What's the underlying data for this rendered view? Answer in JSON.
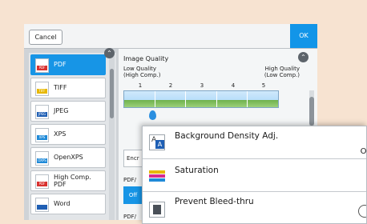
{
  "topbar": {
    "cancel_label": "Cancel",
    "ok_label": "OK"
  },
  "formats": [
    {
      "label": "PDF",
      "badge": "PDF",
      "color": "#d8312f",
      "selected": true
    },
    {
      "label": "TIFF",
      "badge": "TIFF",
      "color": "#e7b800",
      "selected": false
    },
    {
      "label": "JPEG",
      "badge": "JPEG",
      "color": "#1f5fb4",
      "selected": false
    },
    {
      "label": "XPS",
      "badge": "XPS",
      "color": "#1f8ad8",
      "selected": false
    },
    {
      "label": "OpenXPS",
      "badge": "OXPS",
      "color": "#1f8ad8",
      "selected": false
    },
    {
      "label": "High Comp.",
      "label2": "PDF",
      "badge": "PDF",
      "color": "#d8312f",
      "selected": false
    },
    {
      "label": "Word",
      "badge": "",
      "color": "#1f5fb4",
      "selected": false
    }
  ],
  "image_quality": {
    "title": "Image Quality",
    "low_line1": "Low Quality",
    "low_line2": "(High Comp.)",
    "high_line1": "High Quality",
    "high_line2": "(Low Comp.)",
    "ticks": [
      "1",
      "2",
      "3",
      "4",
      "5"
    ],
    "selected_level": 1
  },
  "encryption_label": "Encr",
  "pdfa_label": "PDF/",
  "off_label": "Off",
  "pdfa_label2": "PDF/",
  "popup": {
    "rows": [
      {
        "label": "Background Density Adj.",
        "value": "Of"
      },
      {
        "label": "Saturation",
        "value": "("
      },
      {
        "label": "Prevent Bleed-thru",
        "value": ""
      }
    ]
  },
  "colors": {
    "accent": "#1795e6",
    "background": "#f7e3d1"
  }
}
